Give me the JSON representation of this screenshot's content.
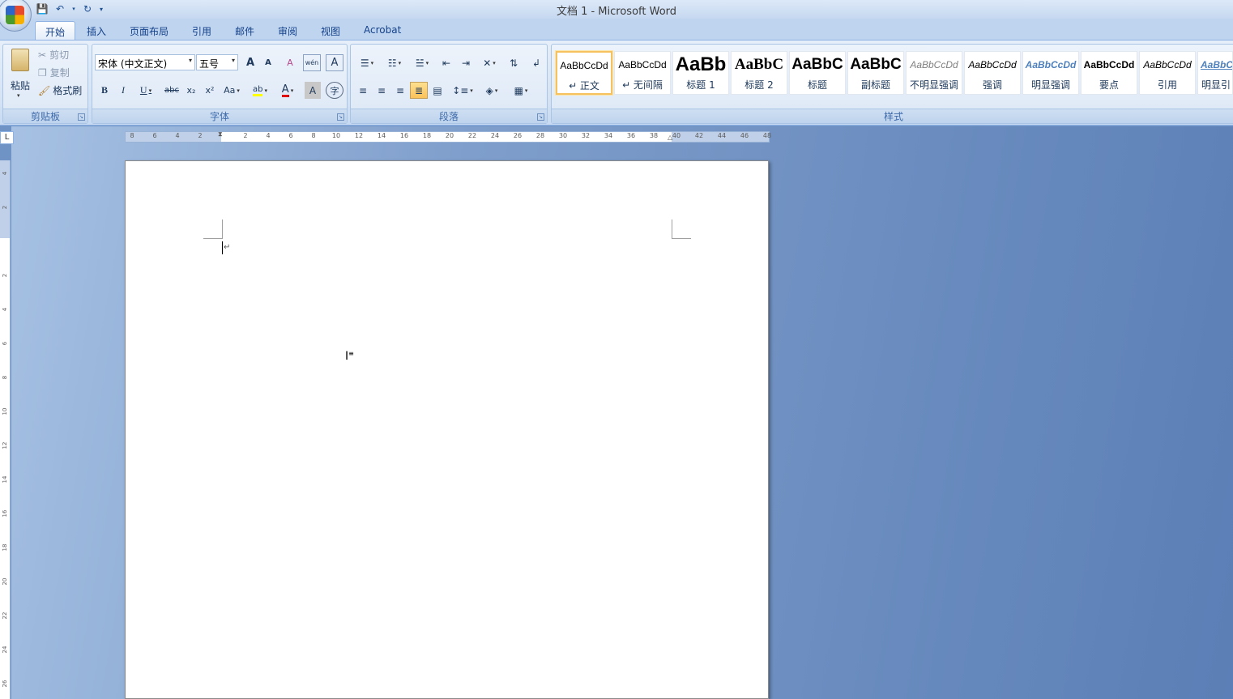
{
  "window": {
    "title": "文档 1 - Microsoft Word"
  },
  "quick_access": {
    "save_icon": "💾",
    "undo_icon": "↶",
    "redo_icon": "↻",
    "customize_icon": "▾"
  },
  "tabs": [
    "开始",
    "插入",
    "页面布局",
    "引用",
    "邮件",
    "审阅",
    "视图",
    "Acrobat"
  ],
  "clipboard": {
    "paste": "粘贴",
    "cut": "剪切",
    "copy": "复制",
    "format_painter": "格式刷",
    "group_label": "剪贴板"
  },
  "font": {
    "font_name": "宋体 (中文正文)",
    "font_size": "五号",
    "group_label": "字体",
    "grow_label": "A",
    "shrink_label": "A",
    "clear_label": "A",
    "phonetic_label": "wén",
    "border_label": "A",
    "bold": "B",
    "italic": "I",
    "underline": "U",
    "strike": "abc",
    "subscript": "x₂",
    "superscript": "x²",
    "case": "Aa",
    "highlight": "ab",
    "color": "A",
    "shade": "A",
    "enclose": "字"
  },
  "paragraph": {
    "group_label": "段落"
  },
  "styles": {
    "group_label": "样式",
    "items": [
      {
        "preview": "AaBbCcDd",
        "name": "↵ 正文"
      },
      {
        "preview": "AaBbCcDd",
        "name": "↵ 无间隔"
      },
      {
        "preview": "AaBb",
        "name": "标题 1"
      },
      {
        "preview": "AaBbC",
        "name": "标题 2"
      },
      {
        "preview": "AaBbC",
        "name": "标题"
      },
      {
        "preview": "AaBbC",
        "name": "副标题"
      },
      {
        "preview": "AaBbCcDd",
        "name": "不明显强调"
      },
      {
        "preview": "AaBbCcDd",
        "name": "强调"
      },
      {
        "preview": "AaBbCcDd",
        "name": "明显强调"
      },
      {
        "preview": "AaBbCcDd",
        "name": "要点"
      },
      {
        "preview": "AaBbCcDd",
        "name": "引用"
      },
      {
        "preview": "AaBbCc",
        "name": "明显引"
      }
    ]
  },
  "ruler": {
    "tab_selector": "L",
    "h_ticks": [
      "8",
      "6",
      "4",
      "2",
      "2",
      "4",
      "6",
      "8",
      "10",
      "12",
      "14",
      "16",
      "18",
      "20",
      "22",
      "24",
      "26",
      "28",
      "30",
      "32",
      "34",
      "36",
      "38",
      "40",
      "42",
      "44",
      "46",
      "48"
    ],
    "v_ticks": [
      "4",
      "2",
      "2",
      "4",
      "6",
      "8",
      "10",
      "12",
      "14",
      "16",
      "18",
      "20",
      "22",
      "24",
      "26"
    ]
  },
  "document": {
    "paragraph_mark": "↵",
    "ibeam": "I"
  }
}
